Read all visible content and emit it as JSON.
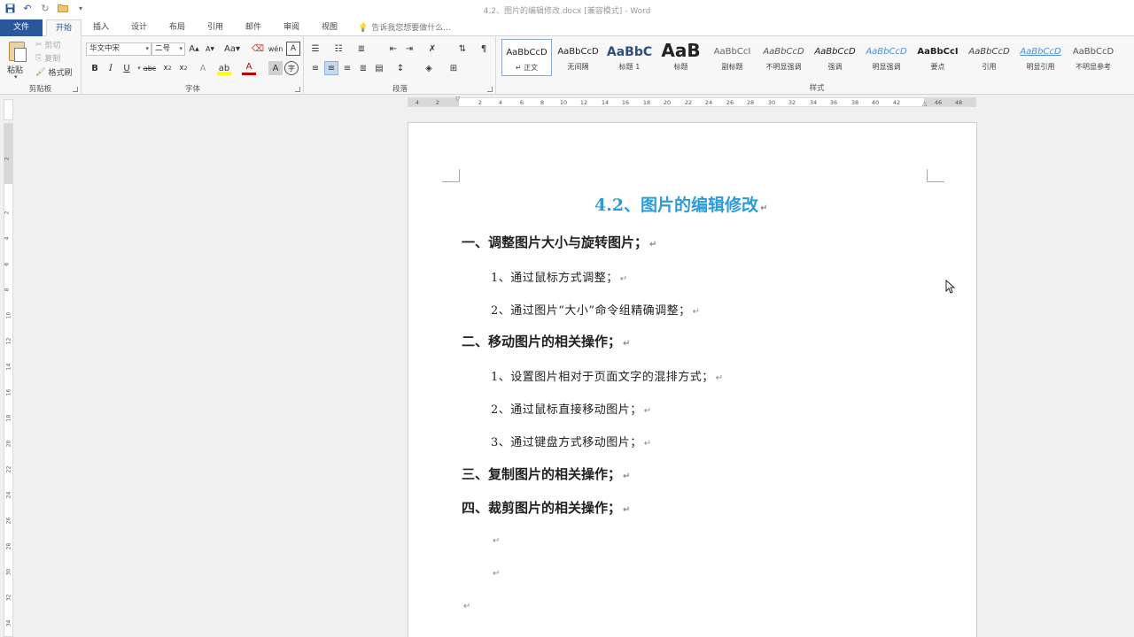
{
  "window": {
    "title": "4.2、图片的编辑修改.docx [兼容模式] - Word"
  },
  "qat": {
    "save_icon": "save-icon",
    "undo_icon": "undo-icon",
    "redo_icon": "redo-icon",
    "open_icon": "open-folder-icon"
  },
  "tabs": [
    "文件",
    "开始",
    "插入",
    "设计",
    "布局",
    "引用",
    "邮件",
    "审阅",
    "视图"
  ],
  "active_tab": "开始",
  "tellme": "告诉我您想要做什么...",
  "clipboard": {
    "paste": "粘贴",
    "cut": "剪切",
    "copy": "复制",
    "format_painter": "格式刷",
    "label": "剪贴板"
  },
  "font": {
    "name": "华文中宋",
    "size": "二号",
    "label": "字体"
  },
  "paragraph": {
    "label": "段落"
  },
  "styles": {
    "label": "样式",
    "items": [
      {
        "preview": "AaBbCcD",
        "name": "↵ 正文"
      },
      {
        "preview": "AaBbCcD",
        "name": "无间隔"
      },
      {
        "preview": "AaBbC",
        "name": "标题 1"
      },
      {
        "preview": "AaB",
        "name": "标题"
      },
      {
        "preview": "AaBbCcI",
        "name": "副标题"
      },
      {
        "preview": "AaBbCcD",
        "name": "不明显强调"
      },
      {
        "preview": "AaBbCcD",
        "name": "强调"
      },
      {
        "preview": "AaBbCcD",
        "name": "明显强调"
      },
      {
        "preview": "AaBbCcI",
        "name": "要点"
      },
      {
        "preview": "AaBbCcD",
        "name": "引用"
      },
      {
        "preview": "AaBbCcD",
        "name": "明显引用"
      },
      {
        "preview": "AaBbCcD",
        "name": "不明显参考"
      }
    ]
  },
  "ruler": {
    "h_ticks": [
      "4",
      "2",
      "2",
      "4",
      "6",
      "8",
      "10",
      "12",
      "14",
      "16",
      "18",
      "20",
      "22",
      "24",
      "26",
      "28",
      "30",
      "32",
      "34",
      "36",
      "38",
      "40",
      "42",
      "46",
      "48"
    ],
    "v_ticks": [
      "2",
      "2",
      "4",
      "6",
      "8",
      "10",
      "12",
      "14",
      "16",
      "18",
      "20",
      "22",
      "24",
      "26",
      "28",
      "30",
      "32",
      "34"
    ]
  },
  "document": {
    "title": "4.2、图片的编辑修改",
    "lines": [
      {
        "kind": "h1",
        "text": "一、调整图片大小与旋转图片；"
      },
      {
        "kind": "item",
        "text": "1、通过鼠标方式调整；"
      },
      {
        "kind": "item",
        "text": "2、通过图片“大小”命令组精确调整；"
      },
      {
        "kind": "h1",
        "text": "二、移动图片的相关操作；"
      },
      {
        "kind": "item",
        "text": "1、设置图片相对于页面文字的混排方式；"
      },
      {
        "kind": "item",
        "text": "2、通过鼠标直接移动图片；"
      },
      {
        "kind": "item",
        "text": "3、通过键盘方式移动图片；"
      },
      {
        "kind": "h1",
        "text": "三、复制图片的相关操作；"
      },
      {
        "kind": "h1",
        "text": "四、裁剪图片的相关操作；"
      },
      {
        "kind": "empty",
        "text": ""
      },
      {
        "kind": "empty",
        "text": ""
      },
      {
        "kind": "empty",
        "text": ""
      }
    ],
    "paragraph_mark": "↵"
  }
}
